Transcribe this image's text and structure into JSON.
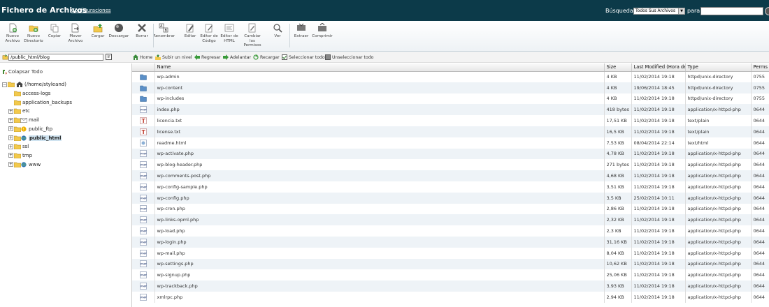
{
  "header": {
    "title": "Fichero de Archivos",
    "config_link": "Configuraciones",
    "search_label": "Búsqueda",
    "search_scope": "Todos Sus Archivos",
    "para_label": "para",
    "search_value": ""
  },
  "toolbar": {
    "items": [
      {
        "label": "Nuevo\nArchivo",
        "icon": "new-file-icon"
      },
      {
        "label": "Nuevo\nDirectorio",
        "icon": "new-folder-icon"
      },
      {
        "label": "Copiar",
        "icon": "copy-icon"
      },
      {
        "label": "Mover\nArchivo",
        "icon": "move-file-icon"
      },
      {
        "label": "Cargar",
        "icon": "upload-icon"
      },
      {
        "label": "Descargar",
        "icon": "download-icon"
      },
      {
        "label": "Borrar",
        "icon": "delete-icon"
      },
      {
        "label": "Renombrar",
        "icon": "rename-icon"
      },
      {
        "label": "Editar",
        "icon": "edit-icon"
      },
      {
        "label": "Editor de\nCódigo",
        "icon": "code-editor-icon"
      },
      {
        "label": "Editor de\nHTML",
        "icon": "html-editor-icon"
      },
      {
        "label": "Cambiar\nlos\nPermisos",
        "icon": "permissions-icon"
      },
      {
        "label": "Ver",
        "icon": "view-icon"
      },
      {
        "label": "Extraer",
        "icon": "extract-icon"
      },
      {
        "label": "Comprimir",
        "icon": "compress-icon"
      }
    ]
  },
  "address": {
    "value": "/public_html/blog",
    "go_label": "Ir"
  },
  "tree": {
    "collapse_label": "Colapsar Todo",
    "root": "(/home/styleand)",
    "nodes": [
      {
        "label": "access-logs",
        "expandable": false
      },
      {
        "label": "application_backups",
        "expandable": false
      },
      {
        "label": "etc",
        "expandable": true
      },
      {
        "label": "mail",
        "expandable": true
      },
      {
        "label": "public_ftp",
        "expandable": true
      },
      {
        "label": "public_html",
        "expandable": true,
        "selected": true
      },
      {
        "label": "ssl",
        "expandable": true
      },
      {
        "label": "tmp",
        "expandable": true
      },
      {
        "label": "www",
        "expandable": true
      }
    ]
  },
  "filebar": {
    "home": "Home",
    "up": "Subir un nivel",
    "back": "Regresar",
    "forward": "Adelantar",
    "reload": "Recargar",
    "select_all": "Seleccionar todo",
    "deselect_all": "Unseleccionar todo"
  },
  "columns": {
    "name": "Name",
    "size": "Size",
    "modified": "Last Modified (Hora de v",
    "type": "Type",
    "perms": "Perms"
  },
  "files": [
    {
      "name": "wp-admin",
      "size": "4 KB",
      "modified": "11/02/2014 19:18",
      "type": "httpd/unix-directory",
      "perms": "0755",
      "icon": "folder"
    },
    {
      "name": "wp-content",
      "size": "4 KB",
      "modified": "19/06/2014 18:45",
      "type": "httpd/unix-directory",
      "perms": "0755",
      "icon": "folder"
    },
    {
      "name": "wp-includes",
      "size": "4 KB",
      "modified": "11/02/2014 19:18",
      "type": "httpd/unix-directory",
      "perms": "0755",
      "icon": "folder"
    },
    {
      "name": "index.php",
      "size": "418 bytes",
      "modified": "11/02/2014 19:18",
      "type": "application/x-httpd-php",
      "perms": "0644",
      "icon": "php"
    },
    {
      "name": "licencia.txt",
      "size": "17,51 KB",
      "modified": "11/02/2014 19:18",
      "type": "text/plain",
      "perms": "0644",
      "icon": "text"
    },
    {
      "name": "license.txt",
      "size": "16,5 KB",
      "modified": "11/02/2014 19:18",
      "type": "text/plain",
      "perms": "0644",
      "icon": "text"
    },
    {
      "name": "readme.html",
      "size": "7,53 KB",
      "modified": "08/04/2014 22:14",
      "type": "text/html",
      "perms": "0644",
      "icon": "html"
    },
    {
      "name": "wp-activate.php",
      "size": "4,78 KB",
      "modified": "11/02/2014 19:18",
      "type": "application/x-httpd-php",
      "perms": "0644",
      "icon": "php"
    },
    {
      "name": "wp-blog-header.php",
      "size": "271 bytes",
      "modified": "11/02/2014 19:18",
      "type": "application/x-httpd-php",
      "perms": "0644",
      "icon": "php"
    },
    {
      "name": "wp-comments-post.php",
      "size": "4,68 KB",
      "modified": "11/02/2014 19:18",
      "type": "application/x-httpd-php",
      "perms": "0644",
      "icon": "php"
    },
    {
      "name": "wp-config-sample.php",
      "size": "3,51 KB",
      "modified": "11/02/2014 19:18",
      "type": "application/x-httpd-php",
      "perms": "0644",
      "icon": "php"
    },
    {
      "name": "wp-config.php",
      "size": "3,5 KB",
      "modified": "25/02/2014 10:11",
      "type": "application/x-httpd-php",
      "perms": "0644",
      "icon": "php"
    },
    {
      "name": "wp-cron.php",
      "size": "2,86 KB",
      "modified": "11/02/2014 19:18",
      "type": "application/x-httpd-php",
      "perms": "0644",
      "icon": "php"
    },
    {
      "name": "wp-links-opml.php",
      "size": "2,32 KB",
      "modified": "11/02/2014 19:18",
      "type": "application/x-httpd-php",
      "perms": "0644",
      "icon": "php"
    },
    {
      "name": "wp-load.php",
      "size": "2,3 KB",
      "modified": "11/02/2014 19:18",
      "type": "application/x-httpd-php",
      "perms": "0644",
      "icon": "php"
    },
    {
      "name": "wp-login.php",
      "size": "31,16 KB",
      "modified": "11/02/2014 19:18",
      "type": "application/x-httpd-php",
      "perms": "0644",
      "icon": "php"
    },
    {
      "name": "wp-mail.php",
      "size": "8,04 KB",
      "modified": "11/02/2014 19:18",
      "type": "application/x-httpd-php",
      "perms": "0644",
      "icon": "php"
    },
    {
      "name": "wp-settings.php",
      "size": "10,62 KB",
      "modified": "11/02/2014 19:18",
      "type": "application/x-httpd-php",
      "perms": "0644",
      "icon": "php"
    },
    {
      "name": "wp-signup.php",
      "size": "25,06 KB",
      "modified": "11/02/2014 19:18",
      "type": "application/x-httpd-php",
      "perms": "0644",
      "icon": "php"
    },
    {
      "name": "wp-trackback.php",
      "size": "3,93 KB",
      "modified": "11/02/2014 19:18",
      "type": "application/x-httpd-php",
      "perms": "0644",
      "icon": "php"
    },
    {
      "name": "xmlrpc.php",
      "size": "2,94 KB",
      "modified": "11/02/2014 19:18",
      "type": "application/x-httpd-php",
      "perms": "0644",
      "icon": "php"
    }
  ],
  "colors": {
    "header_bg": "#0c3a49",
    "row_alt": "#eef3f7",
    "folder": "#f2c94c",
    "dir_icon": "#5b8fc7"
  }
}
